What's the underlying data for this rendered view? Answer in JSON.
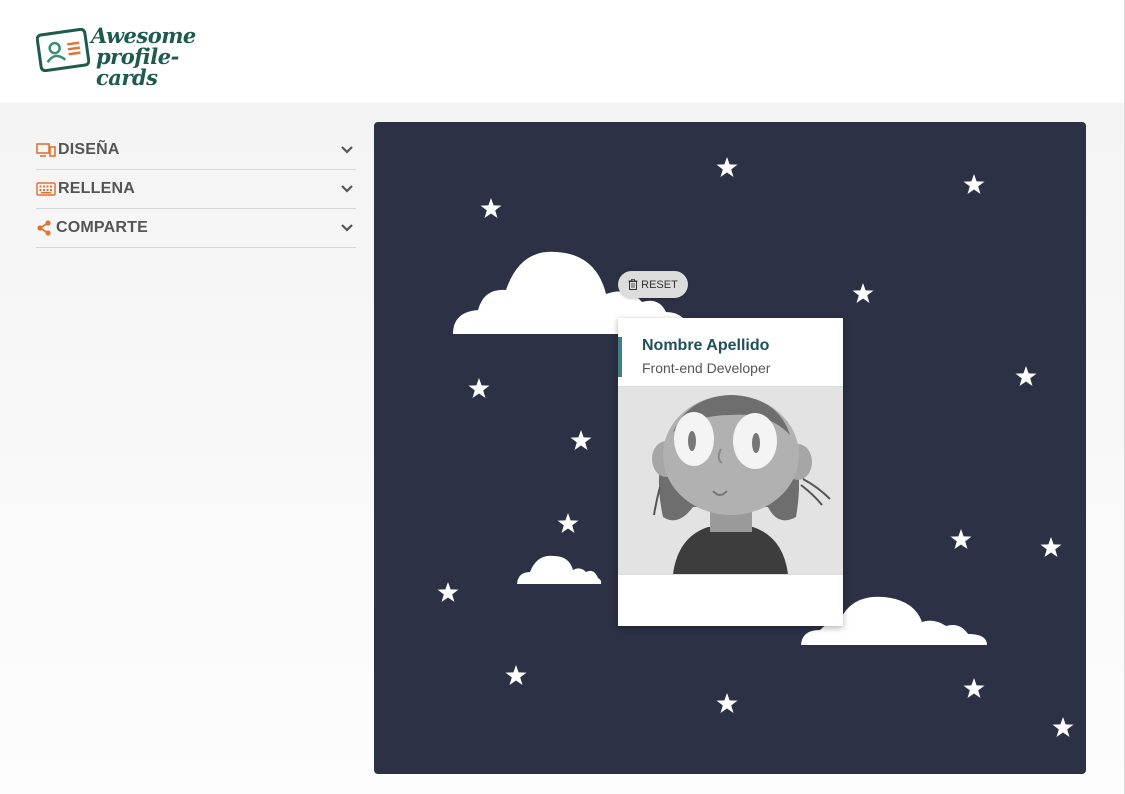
{
  "header": {
    "logo_line1": "Awesome",
    "logo_line2": "profile-cards",
    "logo_icon": "id-card-icon"
  },
  "menu": {
    "items": [
      {
        "label": "DISEÑA",
        "icon": "monitor-icon"
      },
      {
        "label": "RELLENA",
        "icon": "keyboard-icon"
      },
      {
        "label": "COMPARTE",
        "icon": "share-icon"
      }
    ],
    "expand_icon": "chevron-down-icon"
  },
  "preview": {
    "reset_label": "RESET",
    "reset_icon": "trash-icon",
    "card": {
      "name": "Nombre Apellido",
      "job": "Front-end Developer"
    }
  },
  "colors": {
    "accent": "#e17334",
    "brand": "#1f5a4e",
    "preview_bg": "#2c3145",
    "card_bar": "#3e7f89"
  }
}
